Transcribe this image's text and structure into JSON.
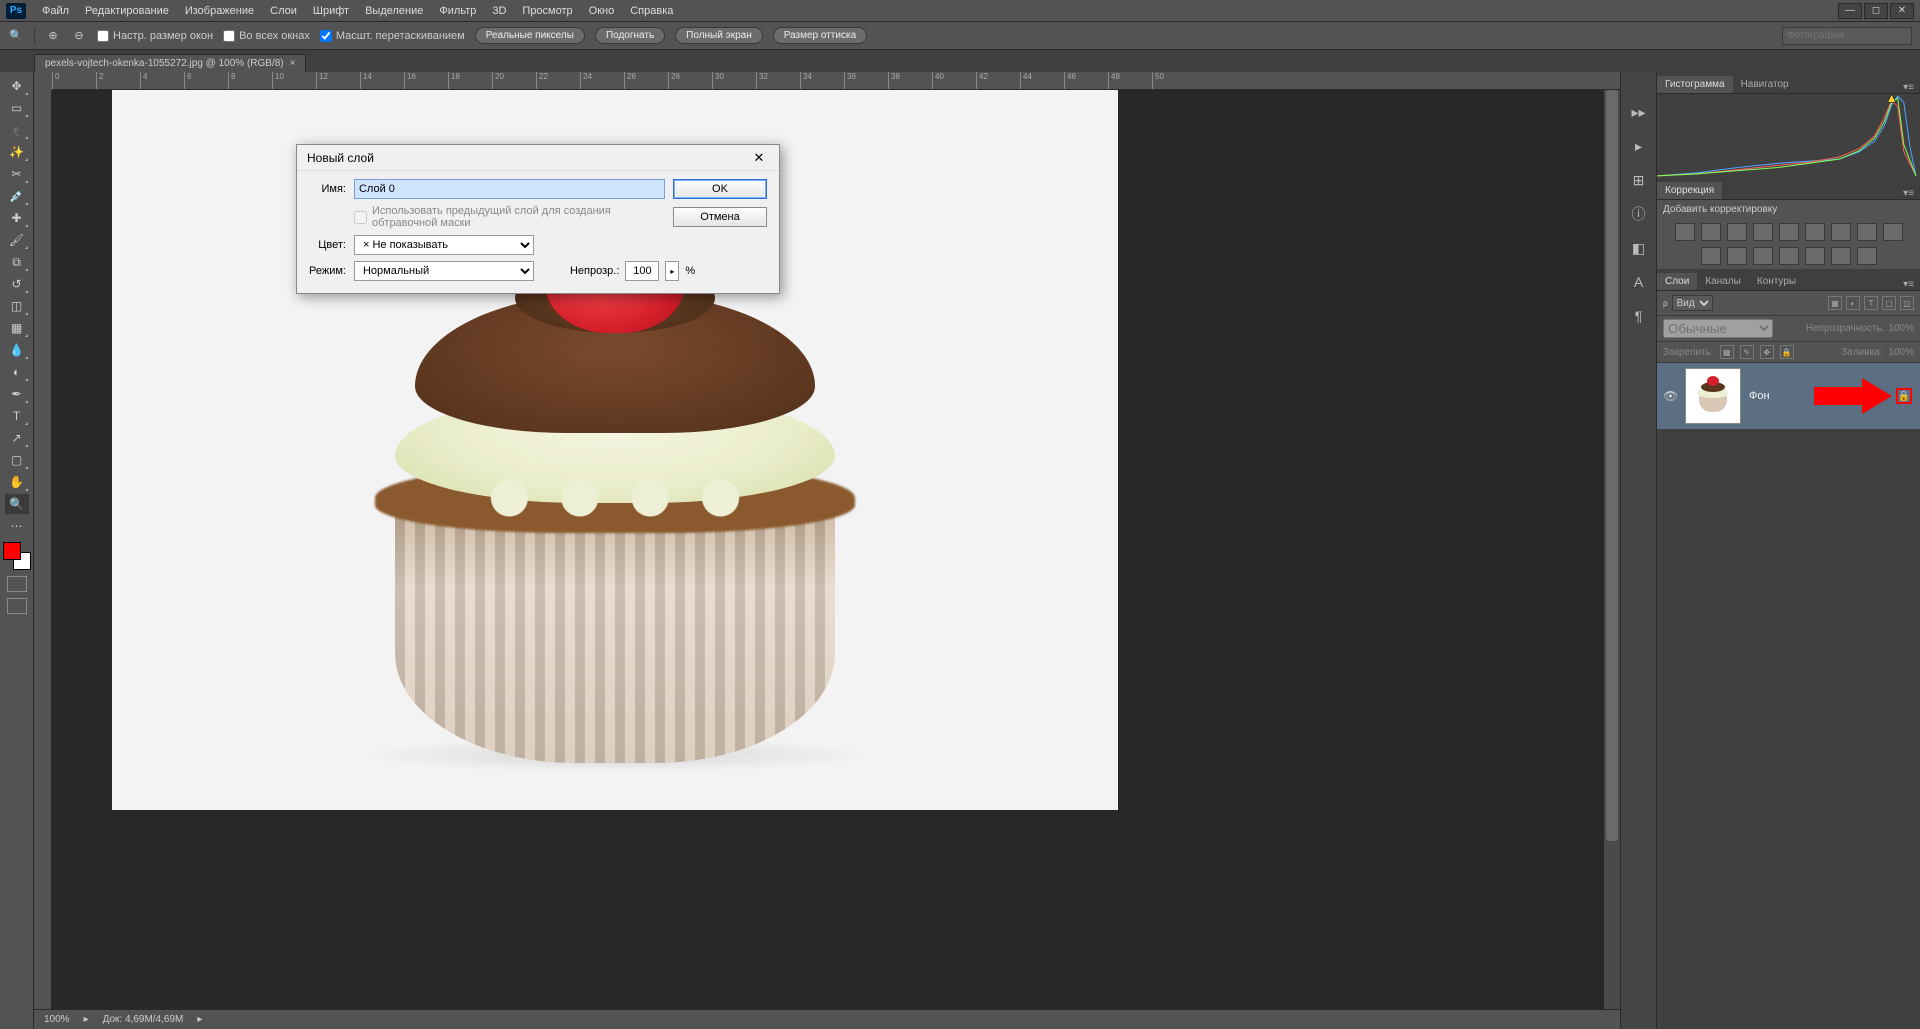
{
  "menu": {
    "items": [
      "Файл",
      "Редактирование",
      "Изображение",
      "Слои",
      "Шрифт",
      "Выделение",
      "Фильтр",
      "3D",
      "Просмотр",
      "Окно",
      "Справка"
    ]
  },
  "options": {
    "check1": "Настр. размер окон",
    "check2": "Во всех окнах",
    "check3": "Масшт. перетаскиванием",
    "buttons": [
      "Реальные пикселы",
      "Подогнать",
      "Полный экран",
      "Размер оттиска"
    ],
    "search_placeholder": "Фотография"
  },
  "docTab": {
    "title": "pexels-vojtech-okenka-1055272.jpg @ 100% (RGB/8)"
  },
  "ruler": {
    "marks": [
      "0",
      "2",
      "4",
      "6",
      "8",
      "10",
      "12",
      "14",
      "16",
      "18",
      "20",
      "22",
      "24",
      "26",
      "28",
      "30",
      "32",
      "34",
      "36",
      "38",
      "40",
      "42",
      "44",
      "46",
      "48",
      "50"
    ]
  },
  "dialog": {
    "title": "Новый слой",
    "name_label": "Имя:",
    "name_value": "Слой 0",
    "clip_label": "Использовать предыдущий слой для создания обтравочной маски",
    "color_label": "Цвет:",
    "color_value": "× Не показывать",
    "mode_label": "Режим:",
    "mode_value": "Нормальный",
    "opacity_label": "Непрозр.:",
    "opacity_value": "100",
    "percent": "%",
    "ok": "OK",
    "cancel": "Отмена"
  },
  "panels": {
    "histogram_tab": "Гистограмма",
    "navigator_tab": "Навигатор",
    "corrections_tab": "Коррекция",
    "corrections_add": "Добавить корректировку",
    "layers_tab": "Слои",
    "channels_tab": "Каналы",
    "paths_tab": "Контуры",
    "kind_label": "Вид",
    "blend_mode": "Обычные",
    "opacity_label": "Непрозрачность:",
    "opacity_val": "100%",
    "lock_label": "Закрепить:",
    "fill_label": "Заливка:",
    "fill_val": "100%",
    "layer_name": "Фон"
  },
  "status": {
    "zoom": "100%",
    "doc": "Док: 4,69M/4,69M"
  },
  "colors": {
    "fg": "#ff0000",
    "bg": "#ffffff"
  }
}
